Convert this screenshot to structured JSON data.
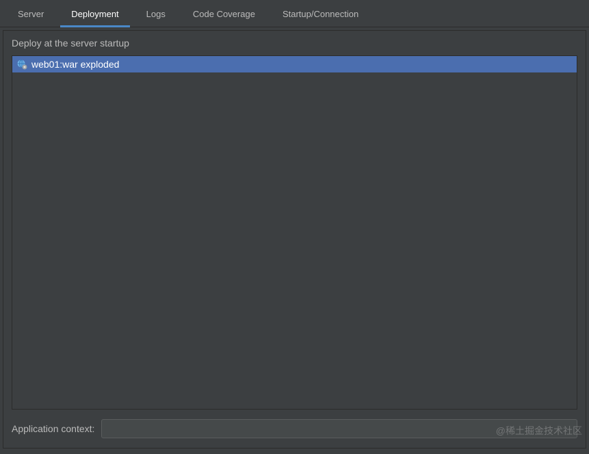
{
  "tabs": {
    "server": "Server",
    "deployment": "Deployment",
    "logs": "Logs",
    "code_coverage": "Code Coverage",
    "startup_connection": "Startup/Connection"
  },
  "section_label": "Deploy at the server startup",
  "artifacts": [
    {
      "label": "web01:war exploded"
    }
  ],
  "app_context": {
    "label": "Application context:",
    "value": ""
  },
  "watermark": "@稀土掘金技术社区"
}
